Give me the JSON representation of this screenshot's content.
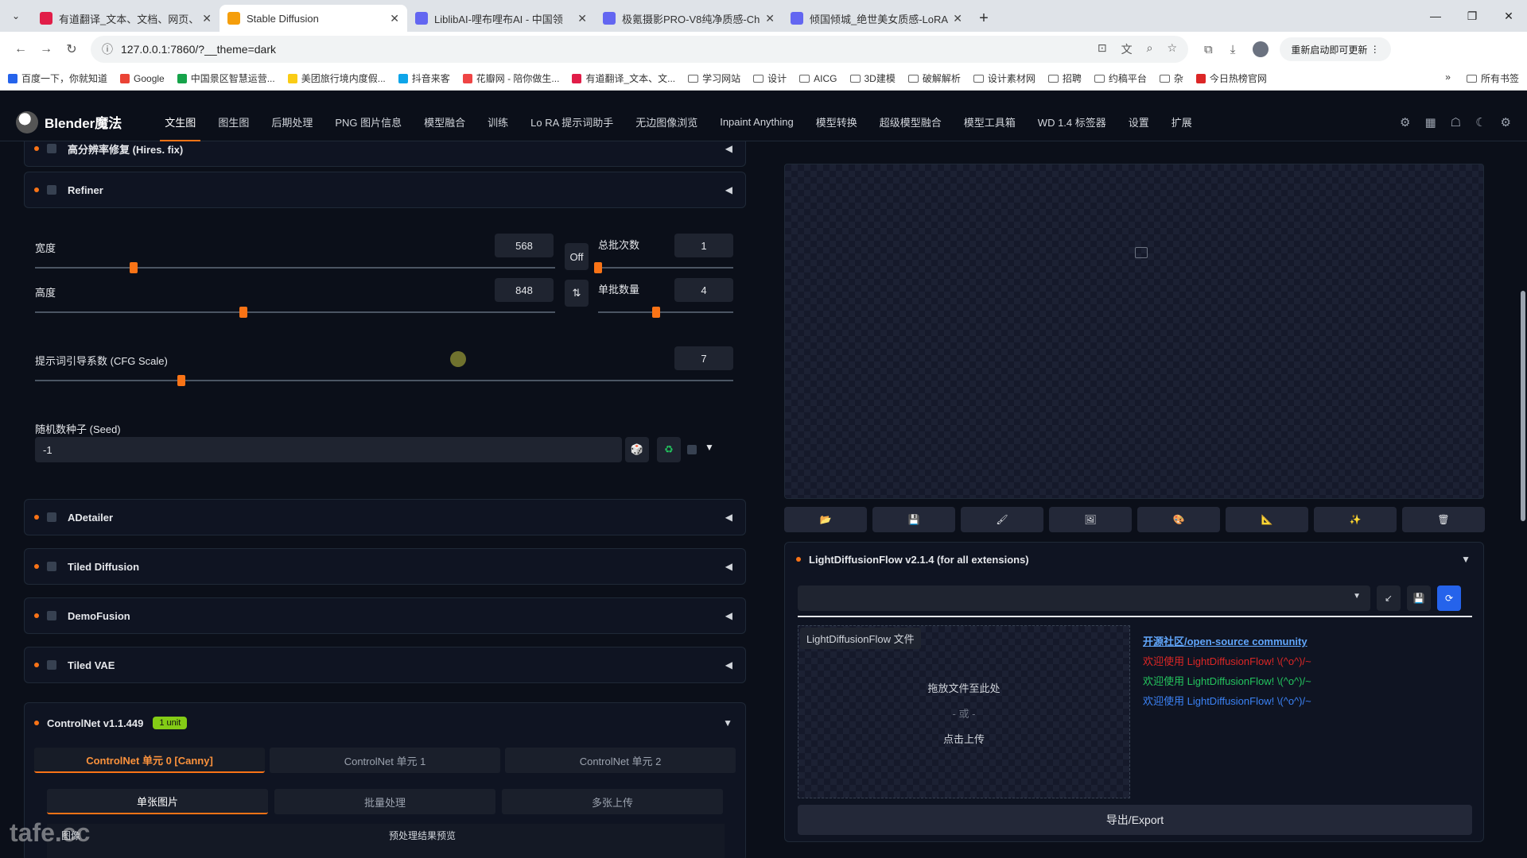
{
  "browser": {
    "tabs": [
      {
        "title": "有道翻译_文本、文档、网页、",
        "icon": "youdao",
        "color": "#e11d48",
        "active": false
      },
      {
        "title": "Stable Diffusion",
        "icon": "sd",
        "color": "#f59e0b",
        "active": true
      },
      {
        "title": "LiblibAI-哩布哩布AI - 中国领",
        "icon": "lib",
        "color": "#6366f1",
        "active": false
      },
      {
        "title": "极氪摄影PRO-V8纯净质感-Ch",
        "icon": "lib",
        "color": "#6366f1",
        "active": false
      },
      {
        "title": "倾国倾城_绝世美女质感-LoRA",
        "icon": "lib",
        "color": "#6366f1",
        "active": false
      }
    ],
    "url": "127.0.0.1:7860/?__theme=dark",
    "update_label": "重新启动即可更新",
    "bookmarks": [
      {
        "label": "百度一下，你就知道",
        "color": "#2563eb"
      },
      {
        "label": "Google",
        "color": "#ea4335"
      },
      {
        "label": "中国景区智慧运营...",
        "color": "#16a34a"
      },
      {
        "label": "美团旅行境内度假...",
        "color": "#facc15"
      },
      {
        "label": "抖音来客",
        "color": "#0ea5e9"
      },
      {
        "label": "花瓣网 - 陪你做生...",
        "color": "#ef4444"
      },
      {
        "label": "有道翻译_文本、文...",
        "color": "#e11d48"
      },
      {
        "label": "学习网站",
        "folder": true
      },
      {
        "label": "设计",
        "folder": true
      },
      {
        "label": "AICG",
        "folder": true
      },
      {
        "label": "3D建模",
        "folder": true
      },
      {
        "label": "破解解析",
        "folder": true
      },
      {
        "label": "设计素材网",
        "folder": true
      },
      {
        "label": "招聘",
        "folder": true
      },
      {
        "label": "约稿平台",
        "folder": true
      },
      {
        "label": "杂",
        "folder": true
      },
      {
        "label": "今日热榜官网",
        "color": "#dc2626"
      }
    ],
    "all_bookmarks": "所有书签"
  },
  "app": {
    "name": "Blender魔法",
    "nav": [
      "文生图",
      "图生图",
      "后期处理",
      "PNG 图片信息",
      "模型融合",
      "训练",
      "Lo RA 提示词助手",
      "无边图像浏览",
      "Inpaint Anything",
      "模型转换",
      "超级模型融合",
      "模型工具箱",
      "WD 1.4 标签器",
      "设置",
      "扩展"
    ],
    "active_nav": "文生图"
  },
  "left": {
    "hires": "高分辨率修复 (Hires. fix)",
    "refiner": "Refiner",
    "width_label": "宽度",
    "width_value": "568",
    "width_fraction": 0.19,
    "height_label": "高度",
    "height_value": "848",
    "height_fraction": 0.4,
    "off_label": "Off",
    "swap_icon": "⇅",
    "batch_count_label": "总批次数",
    "batch_count_value": "1",
    "batch_count_fraction": 0.0,
    "batch_size_label": "单批数量",
    "batch_size_value": "4",
    "batch_size_fraction": 0.43,
    "cfg_label": "提示词引导系数 (CFG Scale)",
    "cfg_value": "7",
    "cfg_fraction": 0.21,
    "seed_label": "随机数种子 (Seed)",
    "seed_value": "-1",
    "accordions": [
      "ADetailer",
      "Tiled Diffusion",
      "DemoFusion",
      "Tiled VAE"
    ],
    "controlnet": {
      "title": "ControlNet v1.1.449",
      "badge": "1 unit",
      "units": [
        "ControlNet 单元 0 [Canny]",
        "ControlNet 单元 1",
        "ControlNet 单元 2"
      ],
      "modes": [
        "单张图片",
        "批量处理",
        "多张上传"
      ],
      "image_label": "图像",
      "preview_label": "预处理结果预览"
    }
  },
  "right": {
    "ldf_title": "LightDiffusionFlow v2.1.4 (for all extensions)",
    "file_label": "LightDiffusionFlow 文件",
    "drop_text": "拖放文件至此处",
    "or_text": "- 或 -",
    "upload_text": "点击上传",
    "community_link": "开源社区/open-source community",
    "welcome_red": "欢迎使用 LightDiffusionFlow! \\(^o^)/~",
    "welcome_green": "欢迎使用 LightDiffusionFlow! \\(^o^)/~",
    "welcome_blue": "欢迎使用 LightDiffusionFlow! \\(^o^)/~",
    "export_label": "导出/Export",
    "tools": [
      "📂",
      "💾",
      "🖌",
      "🖼",
      "🎨",
      "📐",
      "✨",
      "🗑"
    ]
  },
  "watermark": "tafe.cc"
}
